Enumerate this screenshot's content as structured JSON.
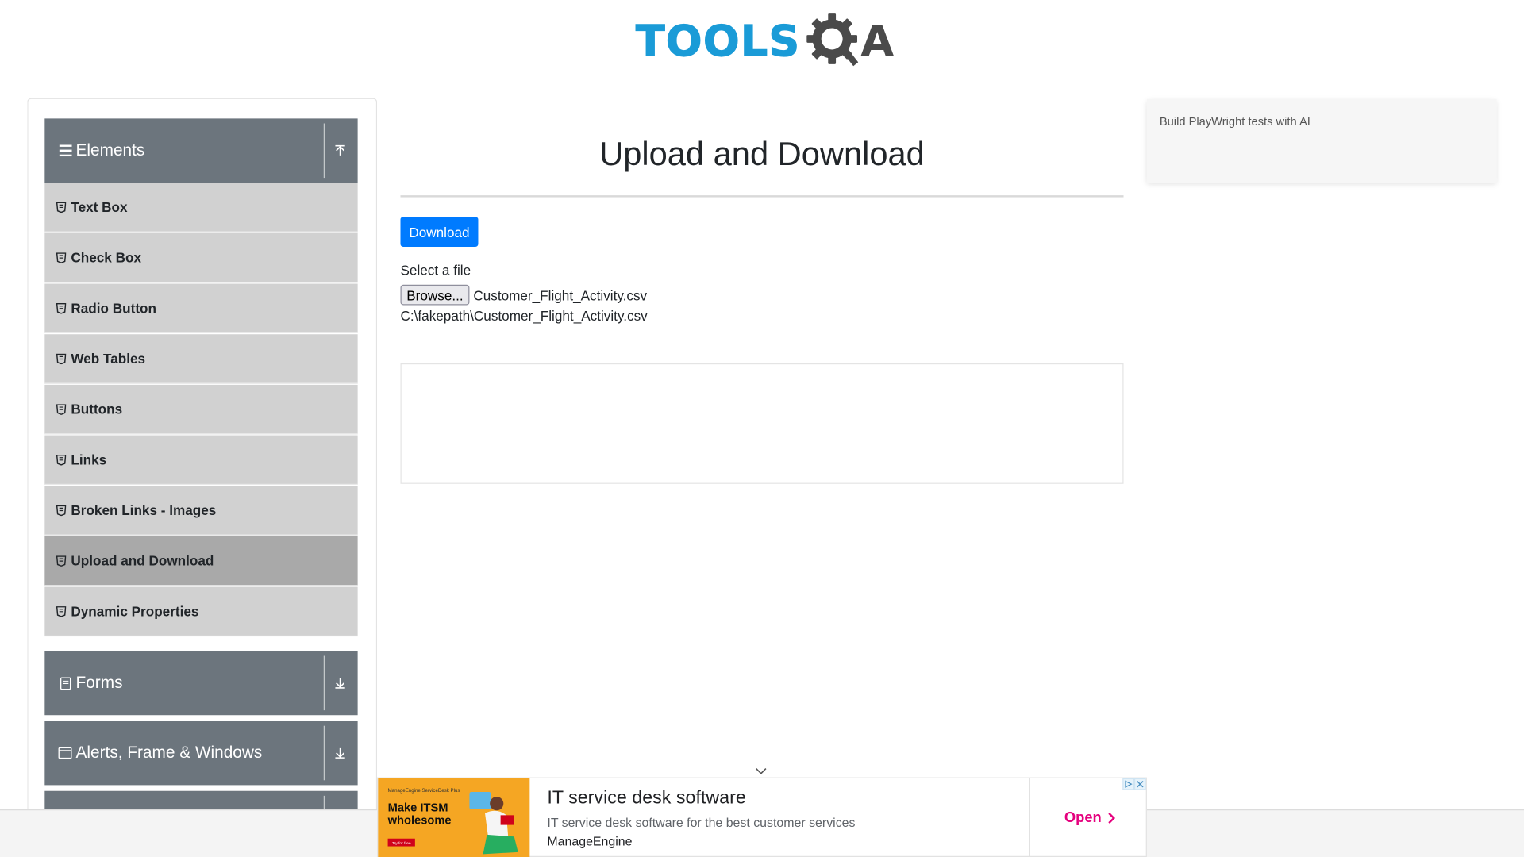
{
  "logo": {
    "text": "TOOLS",
    "suffix": "A"
  },
  "sidebar": {
    "groups": [
      {
        "label": "Elements",
        "icon": "hamburger-icon",
        "toggle": "collapse-up-icon"
      },
      {
        "label": "Forms",
        "icon": "document-icon",
        "toggle": "expand-down-icon"
      },
      {
        "label": "Alerts, Frame & Windows",
        "icon": "window-icon",
        "toggle": "expand-down-icon"
      }
    ],
    "items": [
      {
        "label": "Text Box"
      },
      {
        "label": "Check Box"
      },
      {
        "label": "Radio Button"
      },
      {
        "label": "Web Tables"
      },
      {
        "label": "Buttons"
      },
      {
        "label": "Links"
      },
      {
        "label": "Broken Links - Images"
      },
      {
        "label": "Upload and Download",
        "active": true
      },
      {
        "label": "Dynamic Properties"
      }
    ]
  },
  "main": {
    "title": "Upload and Download",
    "download_label": "Download",
    "file_label": "Select a file",
    "browse_label": "Browse...",
    "file_name": "Customer_Flight_Activity.csv",
    "file_path": "C:\\fakepath\\Customer_Flight_Activity.csv"
  },
  "right_ad": {
    "text": "Build PlayWright tests with AI"
  },
  "ad": {
    "image_brand": "ManageEngine ServiceDesk Plus",
    "image_headline": "Make ITSM wholesome",
    "image_button": "Try for free",
    "title": "IT service desk software",
    "description": "IT service desk software for the best customer services",
    "advertiser": "ManageEngine",
    "open_label": "Open"
  },
  "colors": {
    "brand_blue": "#1a9bd7",
    "sidebar_header": "#6c757d",
    "menu_item": "#d1d1d1",
    "menu_item_active": "#a9a9a9",
    "primary": "#007bff",
    "ad_accent": "#e5007e"
  }
}
